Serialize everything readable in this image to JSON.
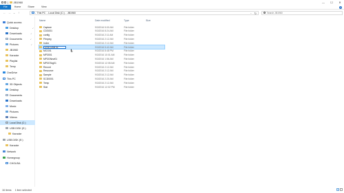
{
  "window": {
    "title": "JB1960"
  },
  "window_controls": {
    "minimize": "—",
    "maximize": "☐",
    "close": "✕"
  },
  "ribbon": {
    "tabs": [
      "File",
      "Home",
      "Share",
      "View"
    ],
    "help": "?"
  },
  "nav_buttons": {
    "back": "←",
    "forward": "→",
    "recent": "⌄",
    "up": "↑"
  },
  "address": {
    "crumbs": [
      "This PC",
      "Local Disk (C:)",
      "JB1960"
    ],
    "separator": "›",
    "dropdown": "⌄",
    "refresh": "↻"
  },
  "search": {
    "placeholder": "Search JB1960"
  },
  "sidebar": {
    "items": [
      {
        "label": "Quick access",
        "icon": "star-icon"
      },
      {
        "label": "Desktop",
        "icon": "desktop-icon",
        "pinned": true
      },
      {
        "label": "Downloads",
        "icon": "download-icon",
        "pinned": true
      },
      {
        "label": "Documents",
        "icon": "document-icon",
        "pinned": true
      },
      {
        "label": "Pictures",
        "icon": "pictures-icon",
        "pinned": true
      },
      {
        "label": "JB1960",
        "icon": "folder-icon"
      },
      {
        "label": "Karaoke",
        "icon": "folder-icon"
      },
      {
        "label": "Playlist",
        "icon": "folder-icon"
      },
      {
        "label": "Temp",
        "icon": "folder-icon"
      },
      {
        "label": "OneDrive",
        "icon": "cloud-icon"
      },
      {
        "label": "This PC",
        "icon": "computer-icon"
      },
      {
        "label": "3D Objects",
        "icon": "cube-icon"
      },
      {
        "label": "Desktop",
        "icon": "desktop-icon"
      },
      {
        "label": "Documents",
        "icon": "document-icon"
      },
      {
        "label": "Downloads",
        "icon": "download-icon"
      },
      {
        "label": "Music",
        "icon": "music-icon"
      },
      {
        "label": "Pictures",
        "icon": "pictures-icon"
      },
      {
        "label": "Videos",
        "icon": "video-icon"
      },
      {
        "label": "Local Disk (C:)",
        "icon": "drive-icon",
        "selected": true
      },
      {
        "label": "USB DISK (E:)",
        "icon": "usb-drive-icon"
      },
      {
        "label": "Karaoke",
        "icon": "folder-icon"
      },
      {
        "label": "USB DISK (E:)",
        "icon": "usb-drive-icon"
      },
      {
        "label": "Karaoke",
        "icon": "folder-icon"
      },
      {
        "label": "Network",
        "icon": "network-icon"
      },
      {
        "label": "Homegroup",
        "icon": "homegroup-icon"
      },
      {
        "label": "CHOUSA",
        "icon": "computer-icon"
      }
    ],
    "pin_glyph": "✓"
  },
  "columns": {
    "name": "Name",
    "date": "Date modified",
    "type": "Type",
    "size": "Size"
  },
  "files": [
    {
      "name": "Capture",
      "date": "9/3/2016 5:00 AM",
      "type": "File folder"
    },
    {
      "name": "CDG001",
      "date": "9/3/2016 8:24 AM",
      "type": "File folder"
    },
    {
      "name": "config",
      "date": "9/3/2016 2:11 AM",
      "type": "File folder"
    },
    {
      "name": "Ffmpeg",
      "date": "9/3/2016 2:12 AM",
      "type": "File folder"
    },
    {
      "name": "Index",
      "date": "9/3/2016 2:12 AM",
      "type": "File folder"
    },
    {
      "name": "DVD USB 01",
      "date": "9/3/2016 5:42 AM",
      "type": "File folder",
      "selected": true,
      "renaming": true
    },
    {
      "name": "MCG01",
      "date": "9/3/2016 8:48 PM",
      "type": "File folder"
    },
    {
      "name": "MP3001",
      "date": "9/3/2016 10:01 AM",
      "type": "File folder"
    },
    {
      "name": "MP3GNew01",
      "date": "9/3/2016 1:56 AM",
      "type": "File folder"
    },
    {
      "name": "MP3GTag01",
      "date": "9/3/2016 12:08 AM",
      "type": "File folder"
    },
    {
      "name": "Record",
      "date": "9/3/2016 2:12 AM",
      "type": "File folder"
    },
    {
      "name": "Resource",
      "date": "9/3/2016 2:12 AM",
      "type": "File folder"
    },
    {
      "name": "Sample",
      "date": "9/3/2016 2:12 AM",
      "type": "File folder"
    },
    {
      "name": "SCD0001",
      "date": "9/3/2016 2:20 AM",
      "type": "File folder"
    },
    {
      "name": "Temp",
      "date": "9/3/2016 2:12 AM",
      "type": "File folder"
    },
    {
      "name": "Stat",
      "date": "9/3/2016 12:02 PM",
      "type": "File folder"
    }
  ],
  "status": {
    "item_count": "16 items",
    "selection": "1 item selected"
  }
}
